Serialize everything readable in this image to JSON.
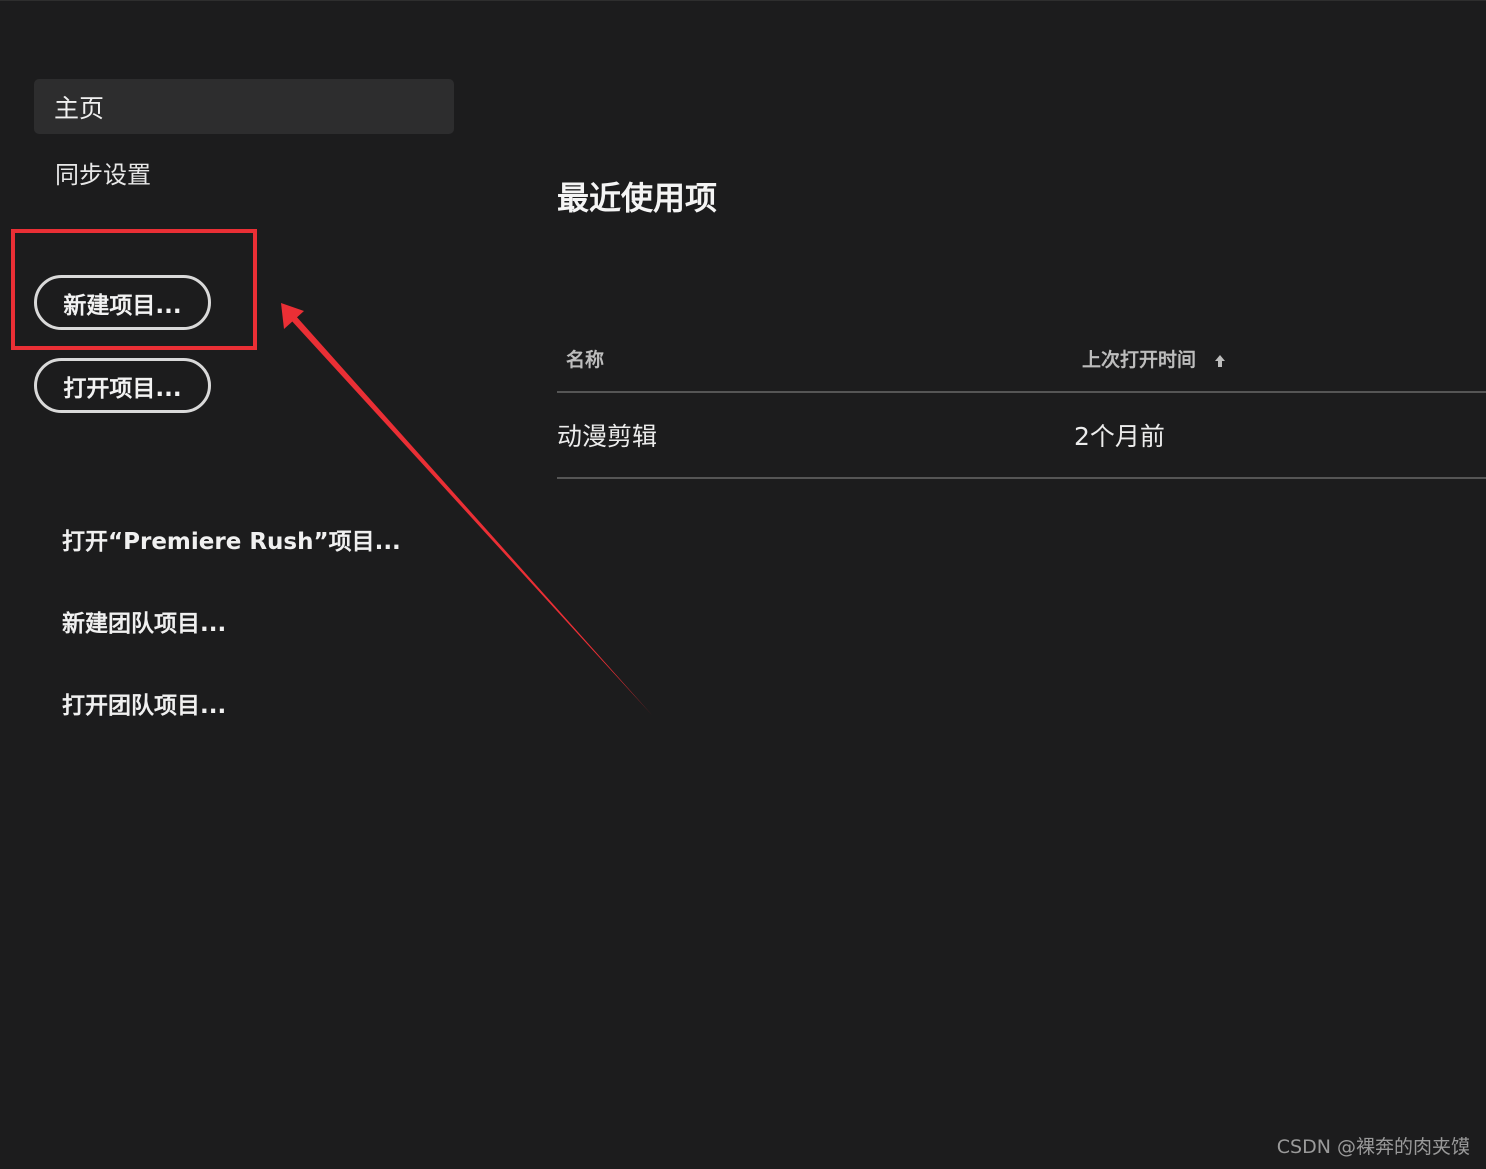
{
  "sidebar": {
    "home_label": "主页",
    "sync_label": "同步设置",
    "new_project_label": "新建项目...",
    "open_project_label": "打开项目...",
    "open_rush_label": "打开“Premiere Rush”项目...",
    "new_team_label": "新建团队项目...",
    "open_team_label": "打开团队项目..."
  },
  "main": {
    "title": "最近使用项",
    "columns": {
      "name": "名称",
      "last_opened": "上次打开时间"
    },
    "sort_icon": "arrow-up-icon",
    "rows": [
      {
        "name": "动漫剪辑",
        "last_opened": "2个月前"
      }
    ]
  },
  "annotation": {
    "color": "#ea2f35"
  },
  "watermark": "CSDN @裸奔的肉夹馍"
}
